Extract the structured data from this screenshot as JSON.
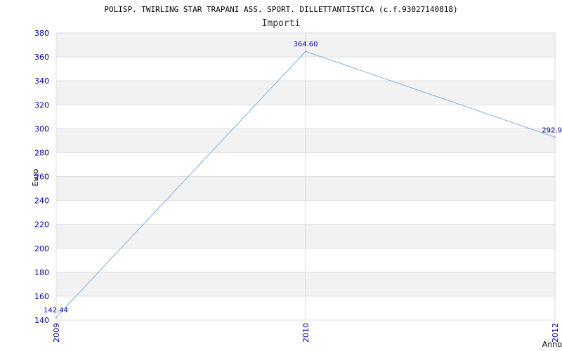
{
  "chart_data": {
    "type": "line",
    "title": "POLISP. TWIRLING STAR TRAPANI ASS. SPORT. DILLETTANTISTICA (c.f.93027140818)",
    "subtitle": "Importi",
    "xlabel": "Anno",
    "ylabel": "Euro",
    "categories": [
      "2009",
      "2010",
      "2012"
    ],
    "series": [
      {
        "values": [
          142.44,
          364.6,
          292.9
        ]
      }
    ],
    "data_labels": [
      "142.44",
      "364.60",
      "292.9"
    ],
    "ylim": [
      140,
      380
    ],
    "yticks": [
      140,
      160,
      180,
      200,
      220,
      240,
      260,
      280,
      300,
      320,
      340,
      360,
      380
    ],
    "grid": true,
    "colors": {
      "line": "#7fb2e6",
      "band": "#f2f2f2",
      "grid": "#dddddd",
      "tick_text": "#0000aa"
    }
  }
}
